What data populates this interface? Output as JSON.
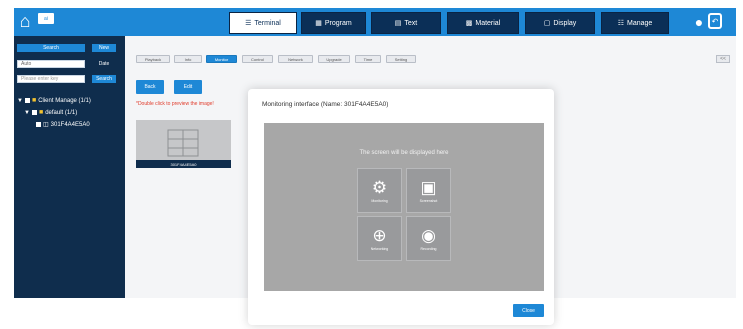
{
  "header": {
    "home_icon": "home-icon",
    "logo_text": "ai",
    "tabs": [
      {
        "label": "Terminal",
        "icon": "list-icon",
        "active": true
      },
      {
        "label": "Program",
        "icon": "program-icon",
        "active": false
      },
      {
        "label": "Text",
        "icon": "text-icon",
        "active": false
      },
      {
        "label": "Material",
        "icon": "material-icon",
        "active": false
      },
      {
        "label": "Display",
        "icon": "display-icon",
        "active": false
      },
      {
        "label": "Manage",
        "icon": "manage-icon",
        "active": false
      }
    ],
    "user_icon": "user-icon",
    "exit_icon": "exit-icon"
  },
  "sidebar": {
    "search_button": "Search",
    "new_button": "New",
    "filter_value": "Auto",
    "filter_label": "Date",
    "search_placeholder": "Please enter key",
    "search_go": "Search",
    "tree": [
      {
        "label": "Client Manage (1/1)",
        "level": 0
      },
      {
        "label": "default (1/1)",
        "level": 1
      },
      {
        "label": "301F4A4E5A0",
        "level": 2
      }
    ]
  },
  "toolbar": {
    "subtabs": [
      "Playback",
      "Info",
      "Monitor",
      "Control",
      "Network",
      "Upgrade",
      "Time",
      "Setting"
    ],
    "active_subtab": "Monitor",
    "collapse_label": "<<",
    "refresh_button": "Back",
    "save_button": "Edit",
    "warning": "*Double click to preview the image!"
  },
  "device_thumbnail": {
    "label": "301F4A4E5A0"
  },
  "modal": {
    "title": "Monitoring interface (Name: 301F4A4E5A0)",
    "prompt": "The screen will be displayed here",
    "buttons": [
      {
        "label": "Monitoring",
        "icon": "gear-icon"
      },
      {
        "label": "Screenshot",
        "icon": "screen-icon"
      },
      {
        "label": "Networking",
        "icon": "globe-icon"
      },
      {
        "label": "Recording",
        "icon": "record-icon"
      }
    ],
    "close_button": "Close"
  },
  "colors": {
    "header_blue": "#1e88d6",
    "nav_dark": "#0b2f57",
    "sidebar_dark": "#0f2d4d",
    "warning_red": "#e03a2a"
  }
}
